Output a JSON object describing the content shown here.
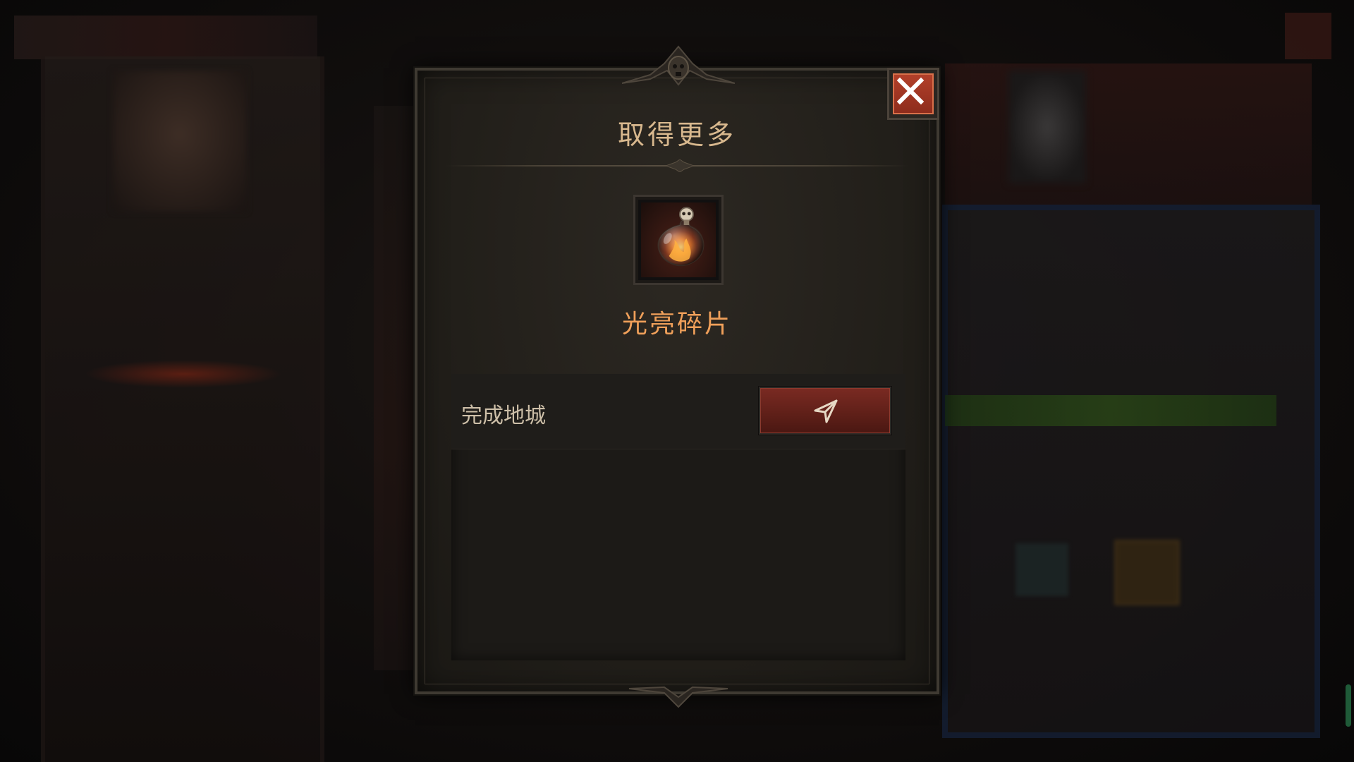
{
  "modal": {
    "title": "取得更多",
    "item": {
      "name": "光亮碎片",
      "icon": "shard-flask-icon"
    },
    "sources": [
      {
        "label": "完成地城",
        "action_icon": "navigate-arrow-icon"
      }
    ],
    "close_icon": "close-icon"
  },
  "colors": {
    "title": "#d8b88e",
    "item_name": "#f0a05a",
    "button_red": "#7a2a22",
    "close_red": "#b2402a"
  }
}
